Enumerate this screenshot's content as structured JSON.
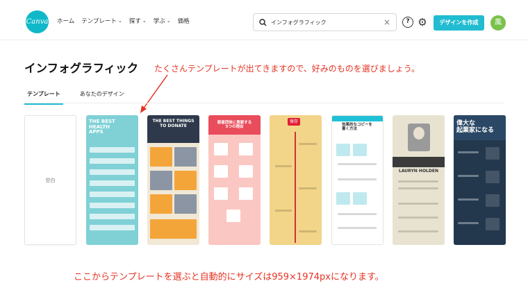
{
  "header": {
    "logo_text": "Canva",
    "nav": [
      {
        "label": "ホーム",
        "has_chevron": false
      },
      {
        "label": "テンプレート",
        "has_chevron": true
      },
      {
        "label": "探す",
        "has_chevron": true
      },
      {
        "label": "学ぶ",
        "has_chevron": true
      },
      {
        "label": "価格",
        "has_chevron": false
      }
    ],
    "search_value": "インフォグラフィック",
    "create_button": "デザインを作成",
    "avatar_text": "風"
  },
  "page": {
    "title": "インフォグラフィック",
    "tabs": [
      {
        "label": "テンプレート",
        "active": true
      },
      {
        "label": "あなたのデザイン",
        "active": false
      }
    ]
  },
  "templates": {
    "blank_label": "空白",
    "cards": [
      {
        "title": "THE BEST\nHEALTH\nAPPS"
      },
      {
        "title": "THE BEST THINGS\nTO DONATE",
        "sections": [
          "TIME TIME",
          "CLEAN UNDERWEAR",
          "SPACE",
          "LAUNDRY SERVICES",
          "CLEANING SUPPLIES",
          "GROCERIES",
          "MONEY"
        ]
      },
      {
        "title": "慈善団体に貢献する\n5つの理由"
      },
      {
        "title": "",
        "badge": "保存"
      },
      {
        "title": "効果的なコピーを\n書く方法"
      },
      {
        "title": "LAURYN HOLDEN",
        "section": "MAJOR MILESTONES"
      },
      {
        "title": "偉大な\n起業家になる"
      }
    ]
  },
  "annotations": {
    "top": "たくさんテンプレートが出てきますので、好みのものを選びましょう。",
    "bottom": "ここからテンプレートを選ぶと自動的にサイズは959×1974pxになります。"
  },
  "colors": {
    "accent": "#21bcd1",
    "annotation": "#e53323",
    "avatar": "#7bc24c"
  }
}
